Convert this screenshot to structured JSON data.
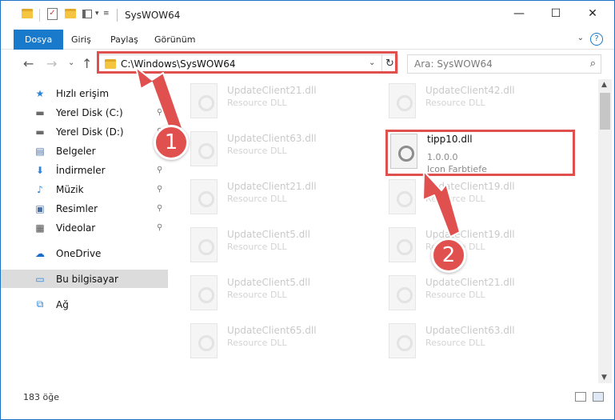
{
  "window": {
    "title": "SysWOW64",
    "minimize": "—",
    "maximize": "☐",
    "close": "✕"
  },
  "ribbon": {
    "tabs": [
      "Dosya",
      "Giriş",
      "Paylaş",
      "Görünüm"
    ],
    "help": "?",
    "expand": "⌄"
  },
  "nav": {
    "back": "←",
    "forward": "→",
    "recent": "⌄",
    "up": "↑",
    "address": "C:\\Windows\\SysWOW64",
    "address_dropdown": "⌄",
    "refresh": "↻",
    "search_placeholder": "Ara: SysWOW64",
    "search_icon": "⌕"
  },
  "sidebar": {
    "items": [
      {
        "label": "Hızlı erişim",
        "icon": "star-icon",
        "glyph": "★",
        "color": "#2b84d6",
        "pin": ""
      },
      {
        "label": "Yerel Disk (C:)",
        "icon": "drive-icon",
        "glyph": "▬",
        "color": "#6b6b6b",
        "pin": "📌"
      },
      {
        "label": "Yerel Disk (D:)",
        "icon": "drive-icon",
        "glyph": "▬",
        "color": "#6b6b6b",
        "pin": "📌"
      },
      {
        "label": "Belgeler",
        "icon": "documents-icon",
        "glyph": "▤",
        "color": "#4a6fa5",
        "pin": "📌"
      },
      {
        "label": "İndirmeler",
        "icon": "downloads-icon",
        "glyph": "⬇",
        "color": "#2b84d6",
        "pin": "📌"
      },
      {
        "label": "Müzik",
        "icon": "music-icon",
        "glyph": "♪",
        "color": "#2b84d6",
        "pin": "📌"
      },
      {
        "label": "Resimler",
        "icon": "pictures-icon",
        "glyph": "▣",
        "color": "#4a6fa5",
        "pin": "📌"
      },
      {
        "label": "Videolar",
        "icon": "videos-icon",
        "glyph": "▦",
        "color": "#4a4a4a",
        "pin": "📌"
      },
      {
        "label": "OneDrive",
        "icon": "onedrive-icon",
        "glyph": "☁",
        "color": "#1a6cc9",
        "pin": ""
      },
      {
        "label": "Bu bilgisayar",
        "icon": "computer-icon",
        "glyph": "▭",
        "color": "#2b84d6",
        "pin": ""
      },
      {
        "label": "Ağ",
        "icon": "network-icon",
        "glyph": "⧉",
        "color": "#2b84d6",
        "pin": ""
      }
    ]
  },
  "files": {
    "left_column": [
      {
        "name": "UpdateClient21.dll",
        "type": "Resource DLL"
      },
      {
        "name": "UpdateClient63.dll",
        "type": "Resource DLL"
      },
      {
        "name": "UpdateClient21.dll",
        "type": "Resource DLL"
      },
      {
        "name": "UpdateClient5.dll",
        "type": "Resource DLL"
      },
      {
        "name": "UpdateClient5.dll",
        "type": "Resource DLL"
      },
      {
        "name": "UpdateClient65.dll",
        "type": "Resource DLL"
      }
    ],
    "right_column": [
      {
        "name": "UpdateClient42.dll",
        "type": "Resource DLL"
      },
      {
        "name": "UpdateClient19.dll",
        "type": "Resource DLL"
      },
      {
        "name": "UpdateClient19.dll",
        "type": "Resource DLL"
      },
      {
        "name": "UpdateClient21.dll",
        "type": "Resource DLL"
      },
      {
        "name": "UpdateClient63.dll",
        "type": "Resource DLL"
      }
    ],
    "highlighted": {
      "name": "tipp10.dll",
      "version": "1.0.0.0",
      "description": "Icon Farbtiefe"
    }
  },
  "status": {
    "count": "183 öğe"
  },
  "callouts": {
    "one": "1",
    "two": "2"
  },
  "colors": {
    "accent": "#1979ca",
    "highlight": "#e0504f",
    "selected": "#dcdcdc"
  }
}
